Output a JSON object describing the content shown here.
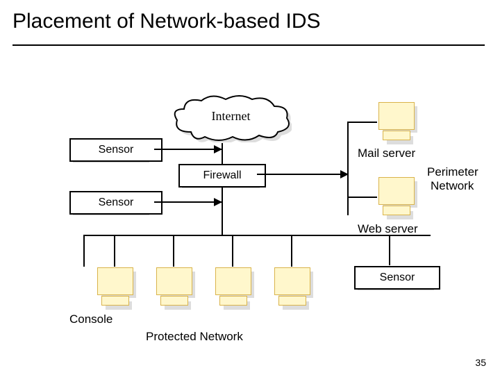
{
  "title": "Placement of Network-based IDS",
  "internet": "Internet",
  "sensor1": "Sensor",
  "sensor2": "Sensor",
  "sensor3": "Sensor",
  "firewall": "Firewall",
  "mail_server": "Mail server",
  "web_server": "Web server",
  "perimeter_line1": "Perimeter",
  "perimeter_line2": "Network",
  "console": "Console",
  "protected_network": "Protected Network",
  "page": "35"
}
